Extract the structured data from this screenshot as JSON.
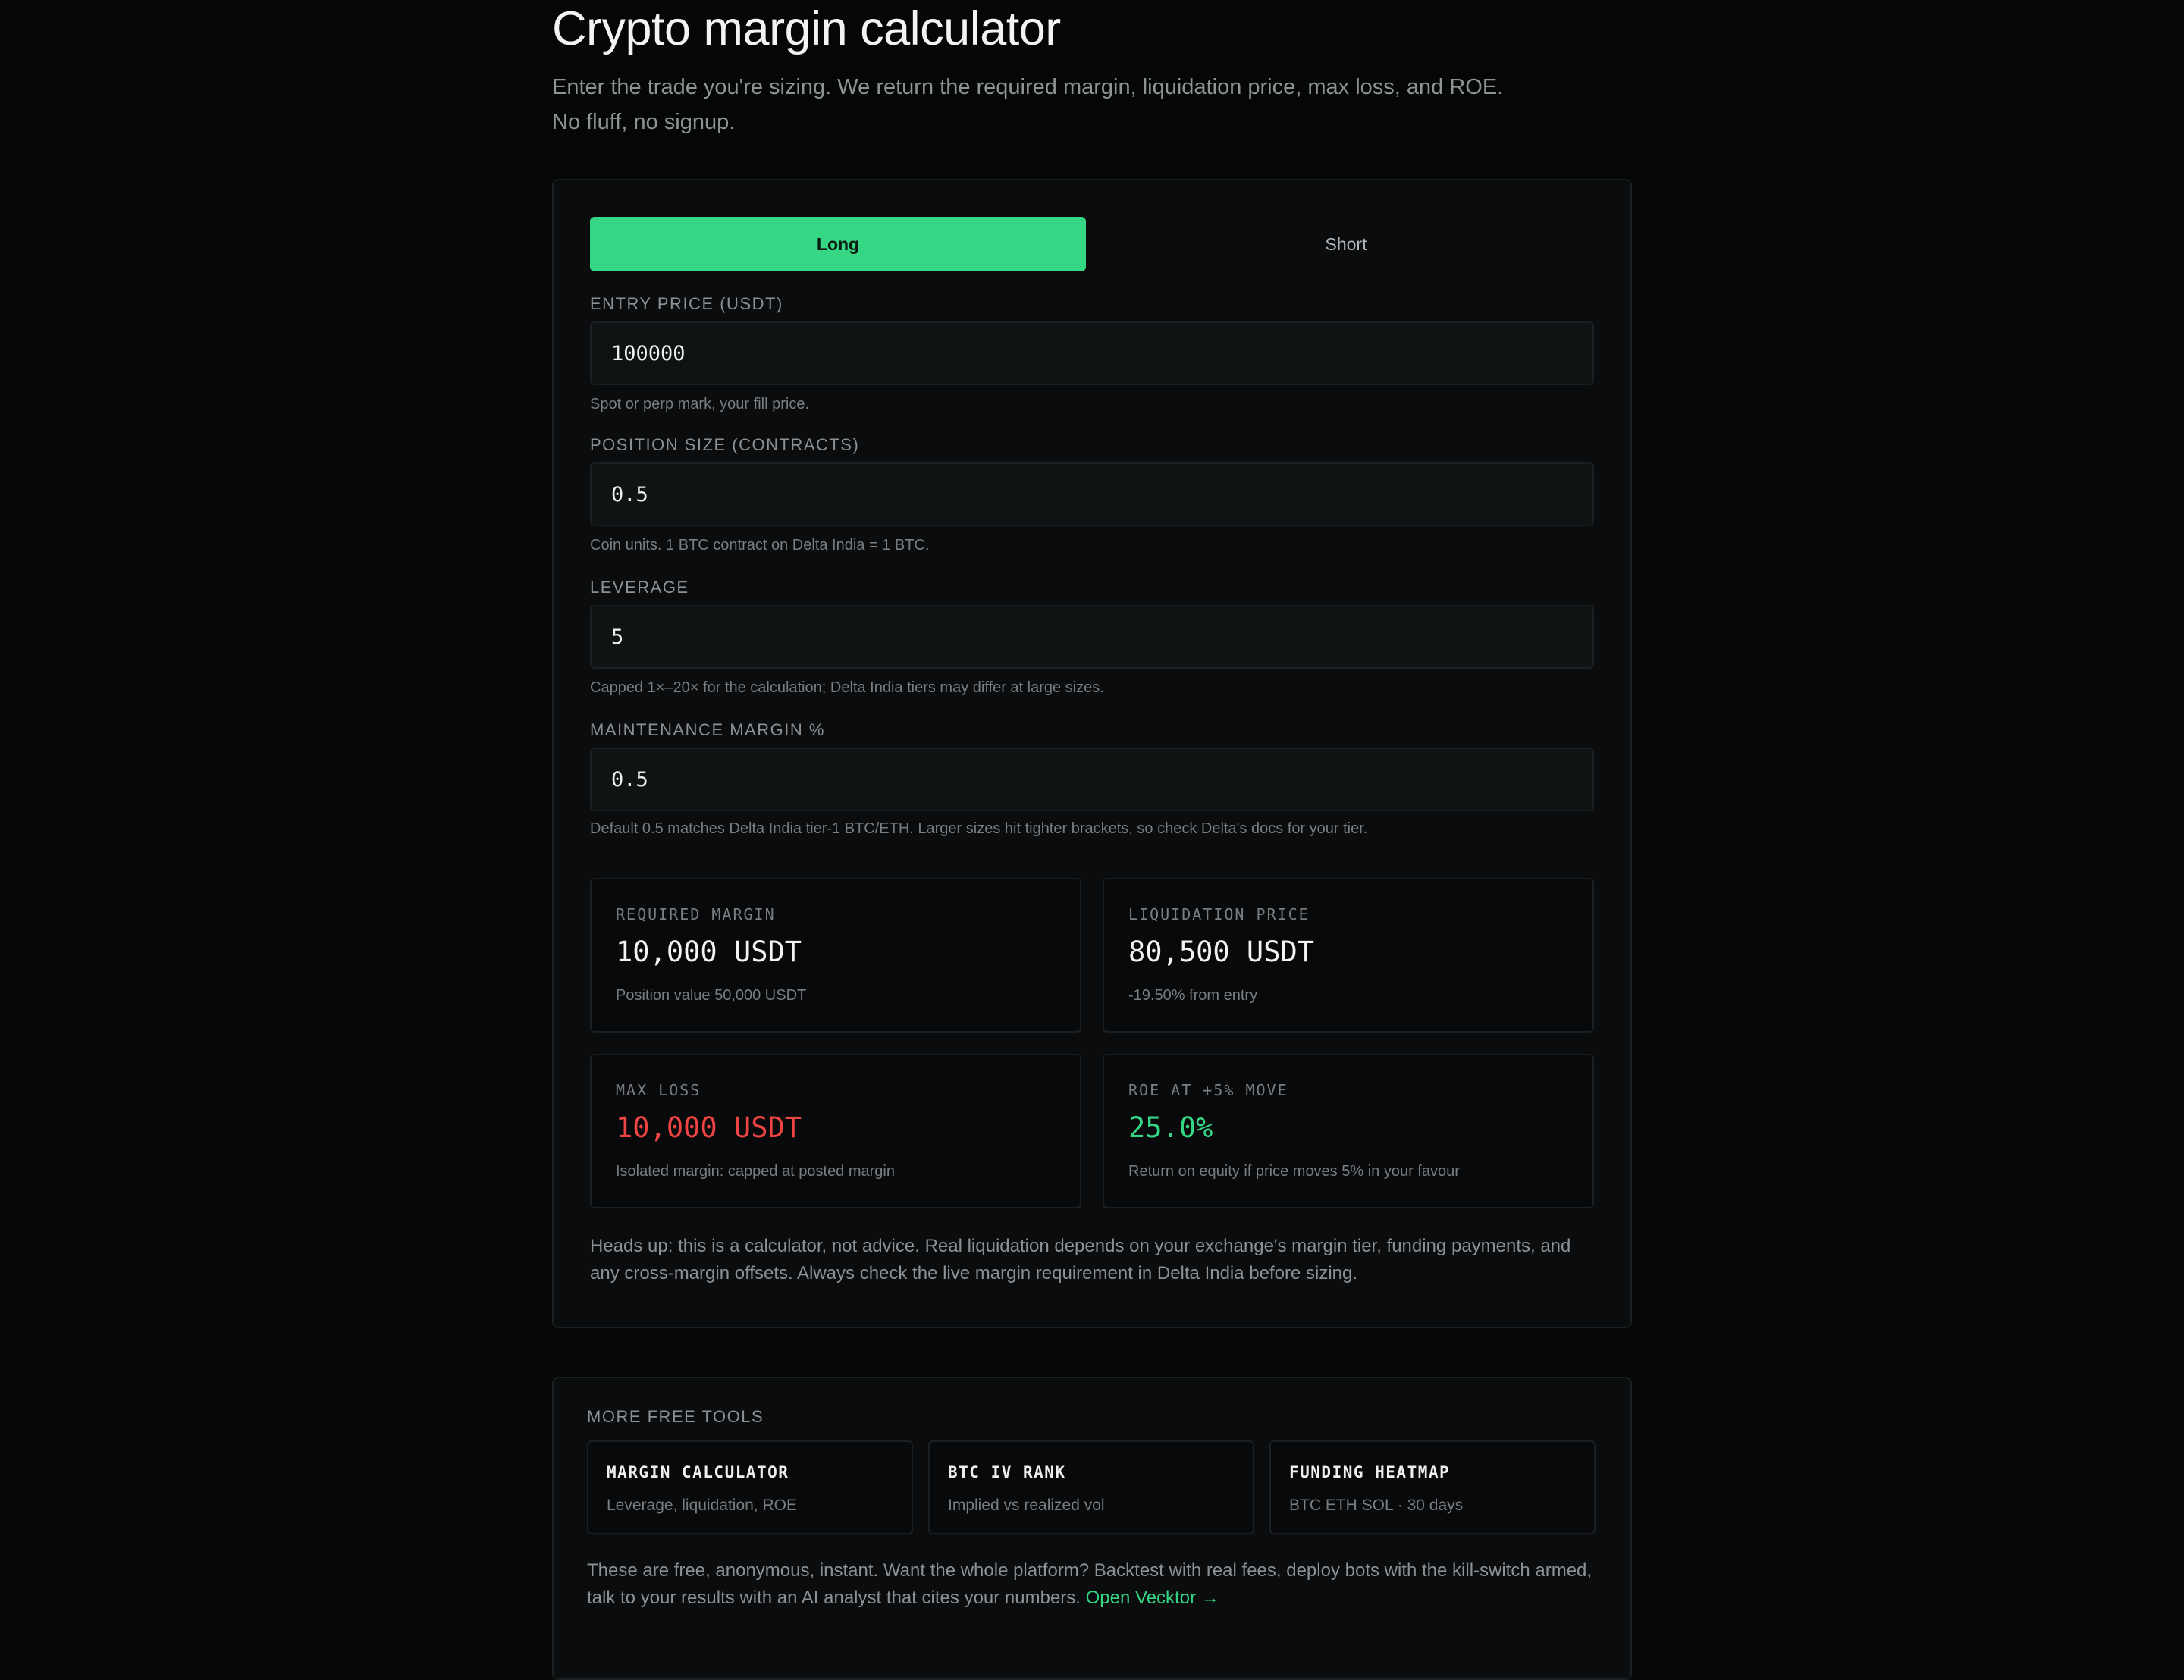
{
  "header": {
    "title": "Crypto margin calculator",
    "subtitle": "Enter the trade you're sizing. We return the required margin, liquidation price, max loss, and ROE. No fluff, no signup."
  },
  "toggle": {
    "long_label": "Long",
    "short_label": "Short",
    "selected": "Long"
  },
  "fields": {
    "entry_price": {
      "label": "ENTRY PRICE (USDT)",
      "value": "100000",
      "hint": "Spot or perp mark, your fill price."
    },
    "position_size": {
      "label": "POSITION SIZE (CONTRACTS)",
      "value": "0.5",
      "hint": "Coin units. 1 BTC contract on Delta India = 1 BTC."
    },
    "leverage": {
      "label": "LEVERAGE",
      "value": "5",
      "hint": "Capped 1×–20× for the calculation; Delta India tiers may differ at large sizes."
    },
    "maintenance_margin": {
      "label": "MAINTENANCE MARGIN %",
      "value": "0.5",
      "hint": "Default 0.5 matches Delta India tier-1 BTC/ETH. Larger sizes hit tighter brackets, so check Delta's docs for your tier."
    }
  },
  "results": {
    "required_margin": {
      "label": "REQUIRED MARGIN",
      "value": "10,000 USDT",
      "sub": "Position value 50,000 USDT"
    },
    "liquidation_price": {
      "label": "LIQUIDATION PRICE",
      "value": "80,500 USDT",
      "sub": "-19.50% from entry"
    },
    "max_loss": {
      "label": "MAX LOSS",
      "value": "10,000 USDT",
      "sub": "Isolated margin: capped at posted margin",
      "color": "#ef4444"
    },
    "roe": {
      "label": "ROE AT +5% MOVE",
      "value": "25.0%",
      "sub": "Return on equity if price moves 5% in your favour",
      "color": "#35d684"
    }
  },
  "disclaimer": "Heads up: this is a calculator, not advice. Real liquidation depends on your exchange's margin tier, funding payments, and any cross-margin offsets. Always check the live margin requirement in Delta India before sizing.",
  "more_tools": {
    "label": "MORE FREE TOOLS",
    "items": [
      {
        "name": "MARGIN CALCULATOR",
        "desc": "Leverage, liquidation, ROE"
      },
      {
        "name": "BTC IV RANK",
        "desc": "Implied vs realized vol"
      },
      {
        "name": "FUNDING HEATMAP",
        "desc": "BTC ETH SOL · 30 days"
      }
    ],
    "text": "These are free, anonymous, instant. Want the whole platform? Backtest with real fees, deploy bots with the kill-switch armed, talk to your results with an AI analyst that cites your numbers.",
    "link_label": "Open Vecktor →"
  },
  "colors": {
    "accent": "#35d684",
    "loss": "#ef4444",
    "background": "#050606"
  }
}
